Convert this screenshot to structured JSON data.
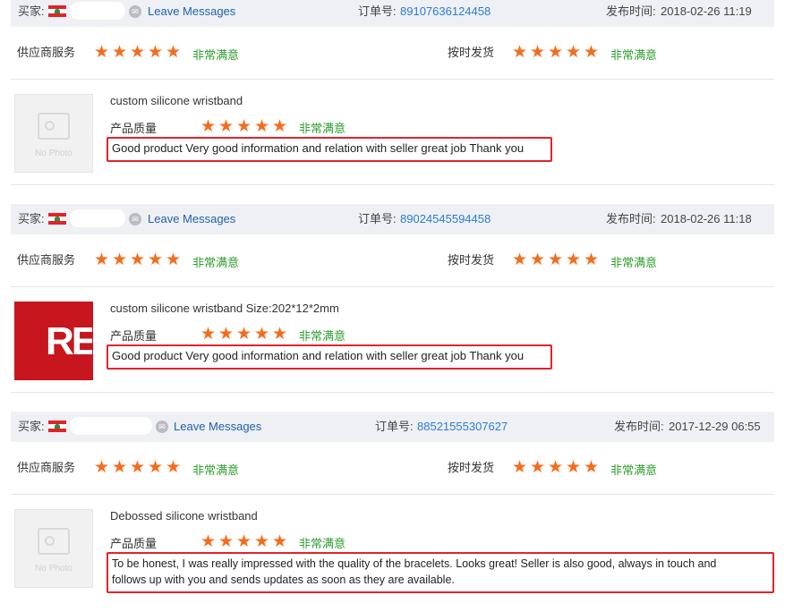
{
  "labels": {
    "buyer": "买家:",
    "leave_messages": "Leave Messages",
    "order_no": "订单号:",
    "post_time": "发布时间:",
    "supplier_service": "供应商服务",
    "on_time_shipping": "按时发货",
    "product_quality": "产品质量",
    "very_satisfied": "非常满意",
    "no_photo": "No Photo"
  },
  "colors": {
    "star": "#f56c1b",
    "satisfied": "#2b9e2b",
    "link": "#1f62a8",
    "order": "#2c7cd0",
    "highlight_border": "#e0242a"
  },
  "reviews": [
    {
      "order_no": "89107636124458",
      "time": "2018-02-26 11:19",
      "product": "custom silicone wristband",
      "thumbnail": "no-photo",
      "comment": "Good product Very good information and relation with seller great job Thank you",
      "supplier_rating": 5,
      "shipping_rating": 5,
      "quality_rating": 5
    },
    {
      "order_no": "89024545594458",
      "time": "2018-02-26 11:18",
      "product": "custom silicone wristband Size:202*12*2mm",
      "thumbnail": "red-image",
      "thumbnail_text": "REC",
      "comment": "Good product Very good information and relation with seller great job Thank you",
      "supplier_rating": 5,
      "shipping_rating": 5,
      "quality_rating": 5
    },
    {
      "order_no": "88521555307627",
      "time": "2017-12-29 06:55",
      "product": "Debossed silicone wristband",
      "thumbnail": "no-photo",
      "comment_line1": "To be honest, I was really impressed with the quality of the bracelets. Looks great! Seller is also good, always in touch and",
      "comment_line2": "follows up with you and sends updates as soon as they are available.",
      "supplier_rating": 5,
      "shipping_rating": 5,
      "quality_rating": 5
    }
  ]
}
